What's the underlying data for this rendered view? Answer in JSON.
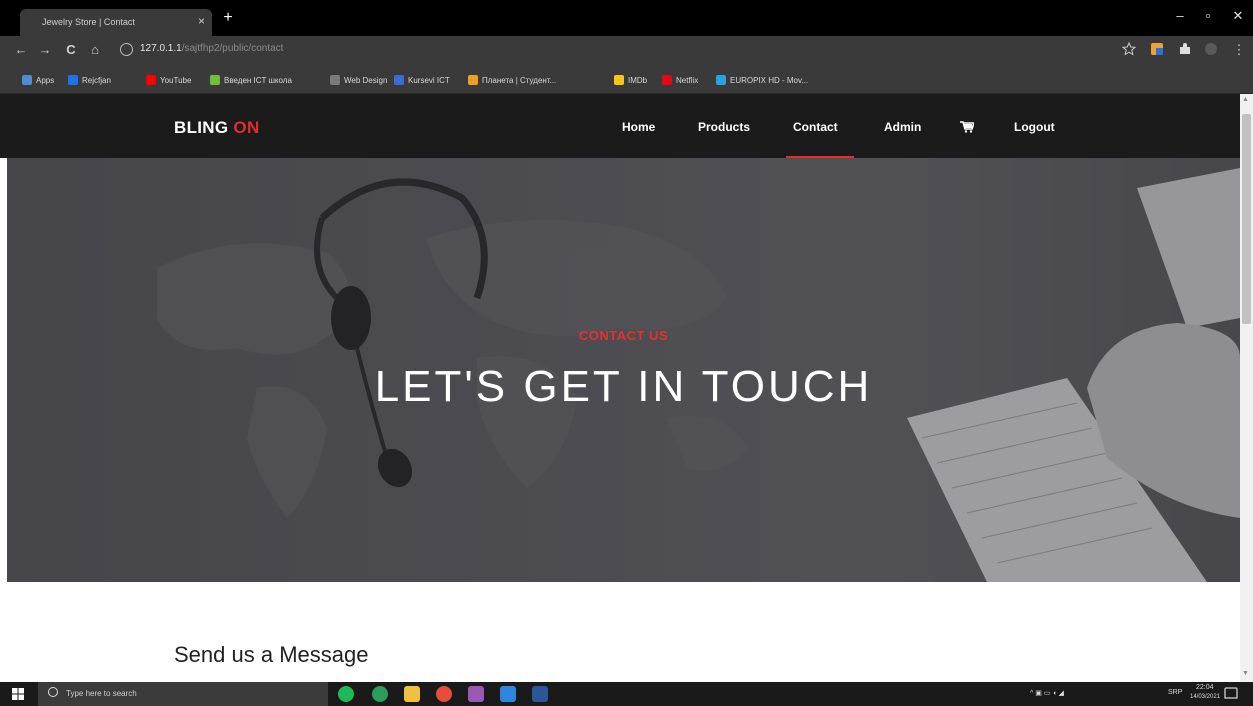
{
  "browser": {
    "tab_title": "Jewelry Store | Contact",
    "url_host": "127.0.1.1",
    "url_path": "/sajtfhp2/public/contact",
    "window_controls": {
      "minimize": "–",
      "maximize": "▫",
      "close": "✕"
    },
    "nav": {
      "back": "←",
      "forward": "→",
      "reload": "C",
      "home": "⌂"
    }
  },
  "bookmarks": [
    {
      "label": "Apps",
      "color": "#4a90d9"
    },
    {
      "label": "Rejcfjan",
      "color": "#1e73e8"
    },
    {
      "label": "YouTube",
      "color": "#ff0000"
    },
    {
      "label": "Введен ICT школа",
      "color": "#6fbf3a"
    },
    {
      "label": "Web Design",
      "color": "#7a7a7a"
    },
    {
      "label": "Kursevi ICT",
      "color": "#3b6fd6"
    },
    {
      "label": "Планета | Студент...",
      "color": "#f0a020"
    },
    {
      "label": "IMDb",
      "color": "#f5c518"
    },
    {
      "label": "Netflix",
      "color": "#e50914"
    },
    {
      "label": "EUROPIX HD - Mov...",
      "color": "#2aa1e0"
    }
  ],
  "site": {
    "brand_main": "BLING ",
    "brand_accent": "ON",
    "nav": [
      {
        "label": "Home",
        "active": false
      },
      {
        "label": "Products",
        "active": false
      },
      {
        "label": "Contact",
        "active": true
      },
      {
        "label": "Admin",
        "active": false
      },
      {
        "label": "Logout",
        "active": false
      }
    ],
    "accent_color": "#e52b2b"
  },
  "hero": {
    "subtitle": "CONTACT US",
    "title": "LET'S GET IN TOUCH"
  },
  "section": {
    "title": "Send us a Message"
  },
  "taskbar": {
    "search_placeholder": "Type here to search",
    "tray_lang": "SRP",
    "time": "22:04",
    "date": "14/03/2021"
  }
}
